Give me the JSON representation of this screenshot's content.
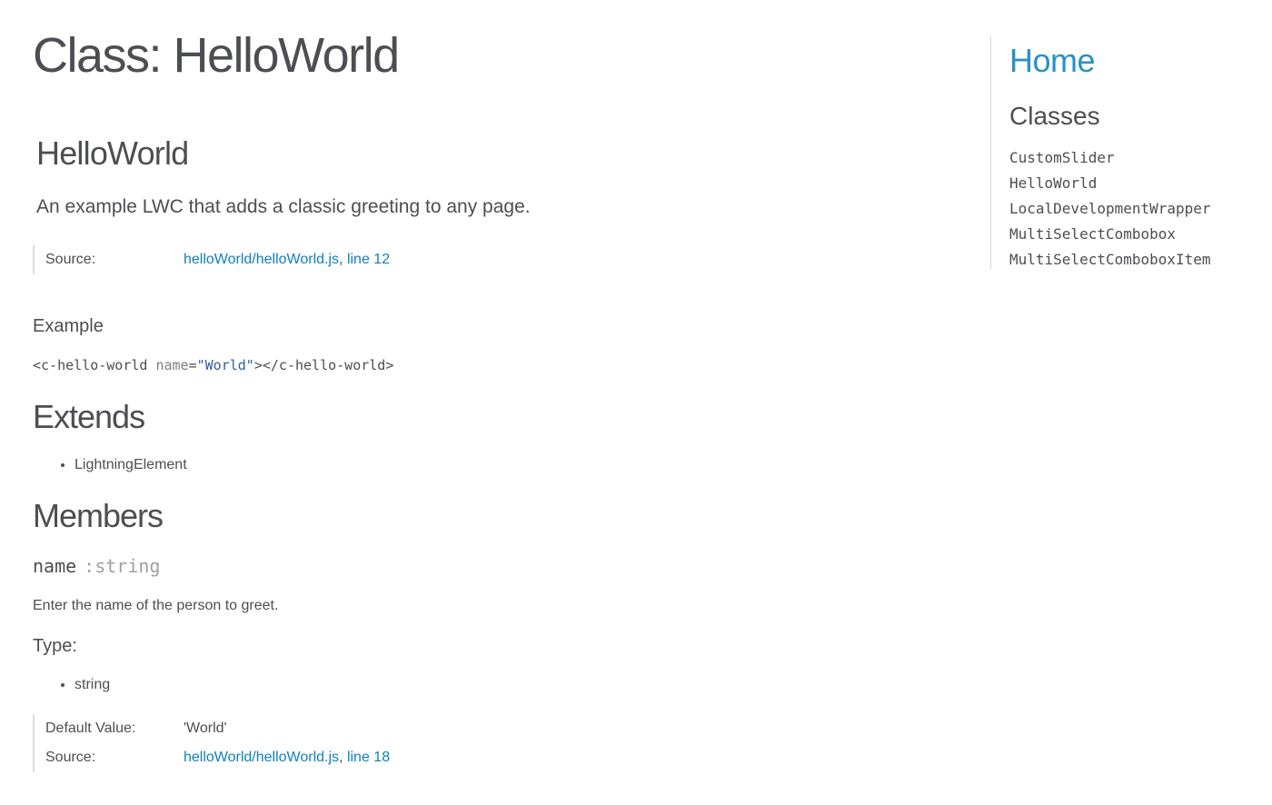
{
  "page_title": "Class: HelloWorld",
  "class_name": "HelloWorld",
  "class_description": "An example LWC that adds a classic greeting to any page.",
  "class_source": {
    "label": "Source:",
    "file": "helloWorld/helloWorld.js",
    "separator": ", ",
    "line": "line 12"
  },
  "example": {
    "heading": "Example",
    "code_open": "<c-hello-world ",
    "code_attr": "name",
    "code_eq": "=",
    "code_value": "\"World\"",
    "code_close": "></c-hello-world>"
  },
  "extends": {
    "heading": "Extends",
    "items": [
      "LightningElement"
    ]
  },
  "members": {
    "heading": "Members",
    "member": {
      "name": "name",
      "type": ":string",
      "description": "Enter the name of the person to greet.",
      "type_heading": "Type:",
      "type_items": [
        "string"
      ],
      "default_label": "Default Value:",
      "default_value": "'World'",
      "source_label": "Source:",
      "source_file": "helloWorld/helloWorld.js",
      "source_separator": ", ",
      "source_line": "line 18"
    }
  },
  "nav": {
    "home": "Home",
    "classes_heading": "Classes",
    "classes": [
      "CustomSlider",
      "HelloWorld",
      "LocalDevelopmentWrapper",
      "MultiSelectCombobox",
      "MultiSelectComboboxItem"
    ]
  },
  "colors": {
    "link": "#0f7fc0",
    "home_link": "#2a90c8",
    "text": "#4d4e53",
    "muted": "#a0a0a5"
  }
}
